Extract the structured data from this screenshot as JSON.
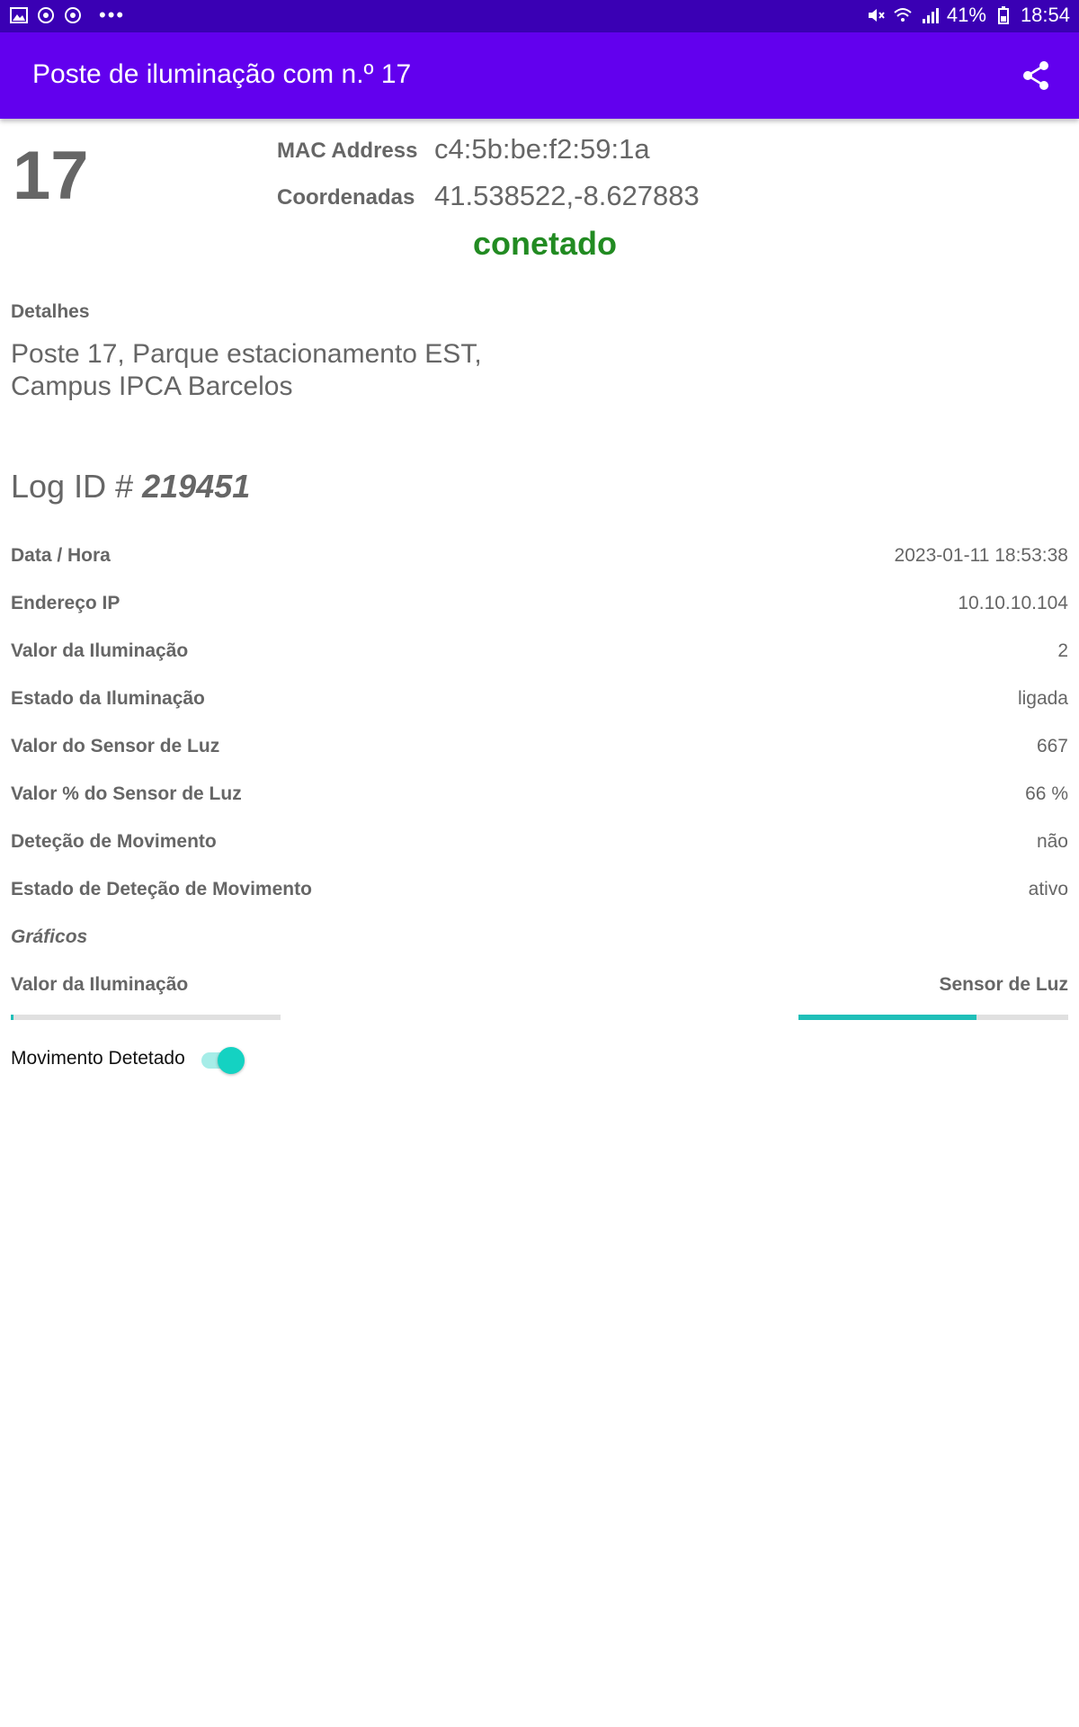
{
  "status_bar": {
    "battery_percent": "41%",
    "time": "18:54",
    "left_icons": [
      "image-icon",
      "sync-icon",
      "sync-icon"
    ],
    "right_icons": [
      "mute-icon",
      "wifi-icon",
      "signal-icon",
      "battery-icon"
    ]
  },
  "app_bar": {
    "title": "Poste de iluminação com n.º 17",
    "share_icon": "share-icon"
  },
  "pole": {
    "number": "17",
    "mac_label": "MAC Address",
    "mac_value": "c4:5b:be:f2:59:1a",
    "coords_label": "Coordenadas",
    "coords_value": "41.538522,-8.627883",
    "status": "conetado",
    "status_color": "#228b22"
  },
  "details": {
    "title": "Detalhes",
    "line1": "Poste 17, Parque estacionamento EST,",
    "line2": "Campus IPCA Barcelos"
  },
  "log": {
    "prefix": "Log ID #",
    "id": "219451"
  },
  "rows": [
    {
      "label": "Data / Hora",
      "value": "2023-01-11 18:53:38"
    },
    {
      "label": "Endereço IP",
      "value": "10.10.10.104"
    },
    {
      "label": "Valor da Iluminação",
      "value": "2"
    },
    {
      "label": "Estado da Iluminação",
      "value": "ligada"
    },
    {
      "label": "Valor do Sensor de Luz",
      "value": "667"
    },
    {
      "label": "Valor % do Sensor de Luz",
      "value": "66 %"
    },
    {
      "label": "Deteção de Movimento",
      "value": "não"
    },
    {
      "label": "Estado de Deteção de Movimento",
      "value": "ativo"
    }
  ],
  "graphs": {
    "title": "Gráficos",
    "left_label": "Valor da Iluminação",
    "right_label": "Sensor de Luz",
    "left_fraction": 0.01,
    "right_fraction": 0.66,
    "accent_color": "#1fbfb8"
  },
  "motion_switch": {
    "label": "Movimento Detetado",
    "checked": true
  }
}
